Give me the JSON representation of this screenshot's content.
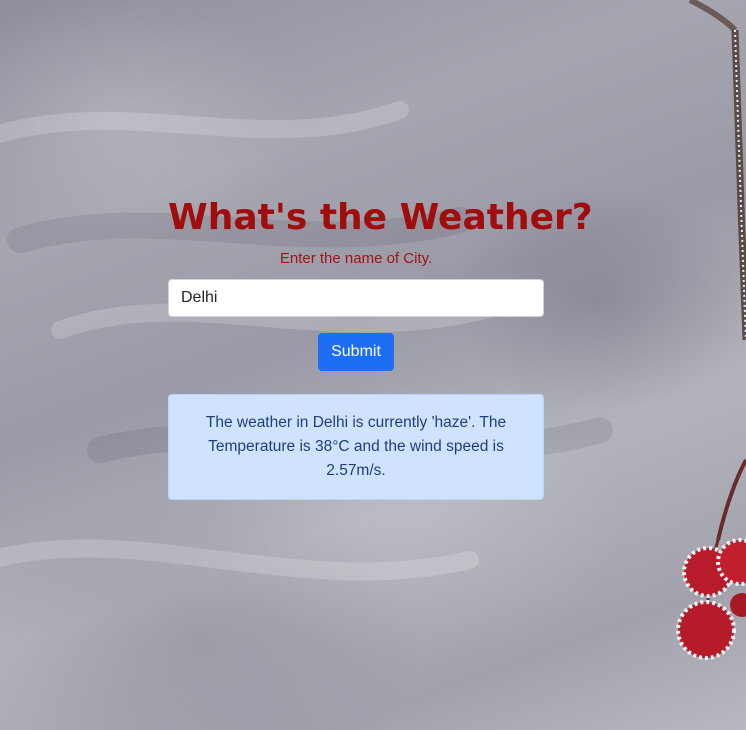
{
  "page": {
    "title": "What's the Weather?",
    "subtitle": "Enter the name of City."
  },
  "form": {
    "city_value": "Delhi",
    "submit_label": "Submit"
  },
  "result": {
    "message": "The weather in Delhi is currently 'haze'. The Temperature is 38°C and the wind speed is 2.57m/s."
  },
  "colors": {
    "title": "#a10d0d",
    "button": "#1d6ef5",
    "alert_bg": "#cfe2ff",
    "alert_text": "#1e3f7a"
  },
  "background": {
    "subject": "frosted-red-berries-branch"
  }
}
